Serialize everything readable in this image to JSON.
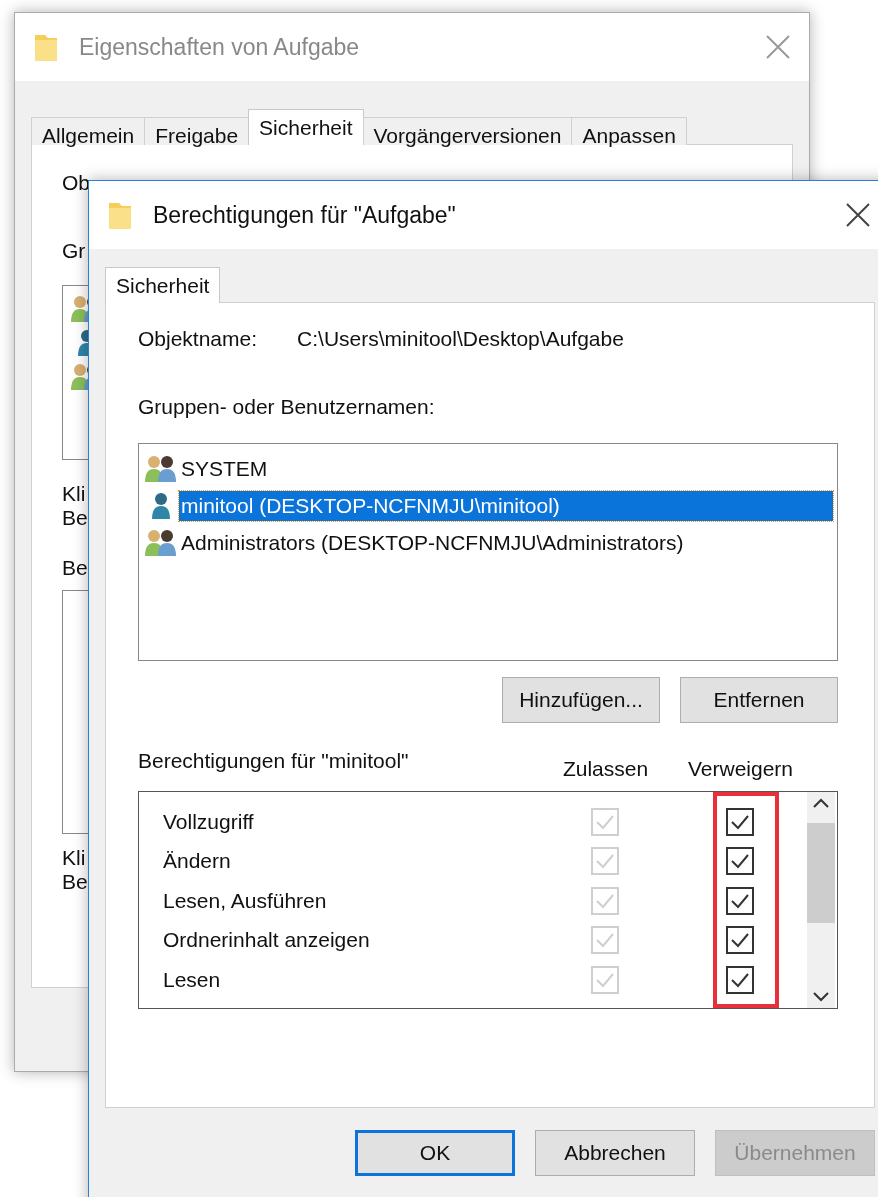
{
  "back_window": {
    "title": "Eigenschaften von Aufgabe",
    "tabs": [
      {
        "label": "Allgemein",
        "selected": false
      },
      {
        "label": "Freigabe",
        "selected": false
      },
      {
        "label": "Sicherheit",
        "selected": true
      },
      {
        "label": "Vorgängerversionen",
        "selected": false
      },
      {
        "label": "Anpassen",
        "selected": false
      }
    ],
    "object_label": "Ob",
    "groups_label": "Gr",
    "principal_icons": [
      {
        "kind": "group"
      },
      {
        "kind": "user"
      },
      {
        "kind": "group"
      }
    ],
    "hint_1": [
      "Kli",
      "Be"
    ],
    "permissions_label": "Be",
    "hint_2": [
      "Kli",
      "Be"
    ]
  },
  "dialog": {
    "title": "Berechtigungen für \"Aufgabe\"",
    "tabs": [
      {
        "label": "Sicherheit",
        "selected": true
      }
    ],
    "object_label": "Objektname:",
    "object_value": "C:\\Users\\minitool\\Desktop\\Aufgabe",
    "groups_label": "Gruppen- oder Benutzernamen:",
    "principals": [
      {
        "name": "SYSTEM",
        "kind": "group",
        "selected": false
      },
      {
        "name": "minitool (DESKTOP-NCFNMJU\\minitool)",
        "kind": "user",
        "selected": true
      },
      {
        "name": "Administrators (DESKTOP-NCFNMJU\\Administrators)",
        "kind": "group",
        "selected": false
      }
    ],
    "list_buttons": [
      "Hinzufügen...",
      "Entfernen"
    ],
    "permissions_label": "Berechtigungen für \"minitool\"",
    "columns": [
      "Zulassen",
      "Verweigern"
    ],
    "permissions": [
      {
        "name": "Vollzugriff",
        "allow": true,
        "allow_disabled": true,
        "deny": true
      },
      {
        "name": "Ändern",
        "allow": true,
        "allow_disabled": true,
        "deny": true
      },
      {
        "name": "Lesen, Ausführen",
        "allow": true,
        "allow_disabled": true,
        "deny": true
      },
      {
        "name": "Ordnerinhalt anzeigen",
        "allow": true,
        "allow_disabled": true,
        "deny": true
      },
      {
        "name": "Lesen",
        "allow": true,
        "allow_disabled": true,
        "deny": true
      }
    ],
    "deny_highlighted": true,
    "buttons": [
      {
        "label": "OK",
        "kind": "default",
        "disabled": false
      },
      {
        "label": "Abbrechen",
        "kind": "normal",
        "disabled": false
      },
      {
        "label": "Übernehmen",
        "kind": "normal",
        "disabled": true
      }
    ]
  }
}
